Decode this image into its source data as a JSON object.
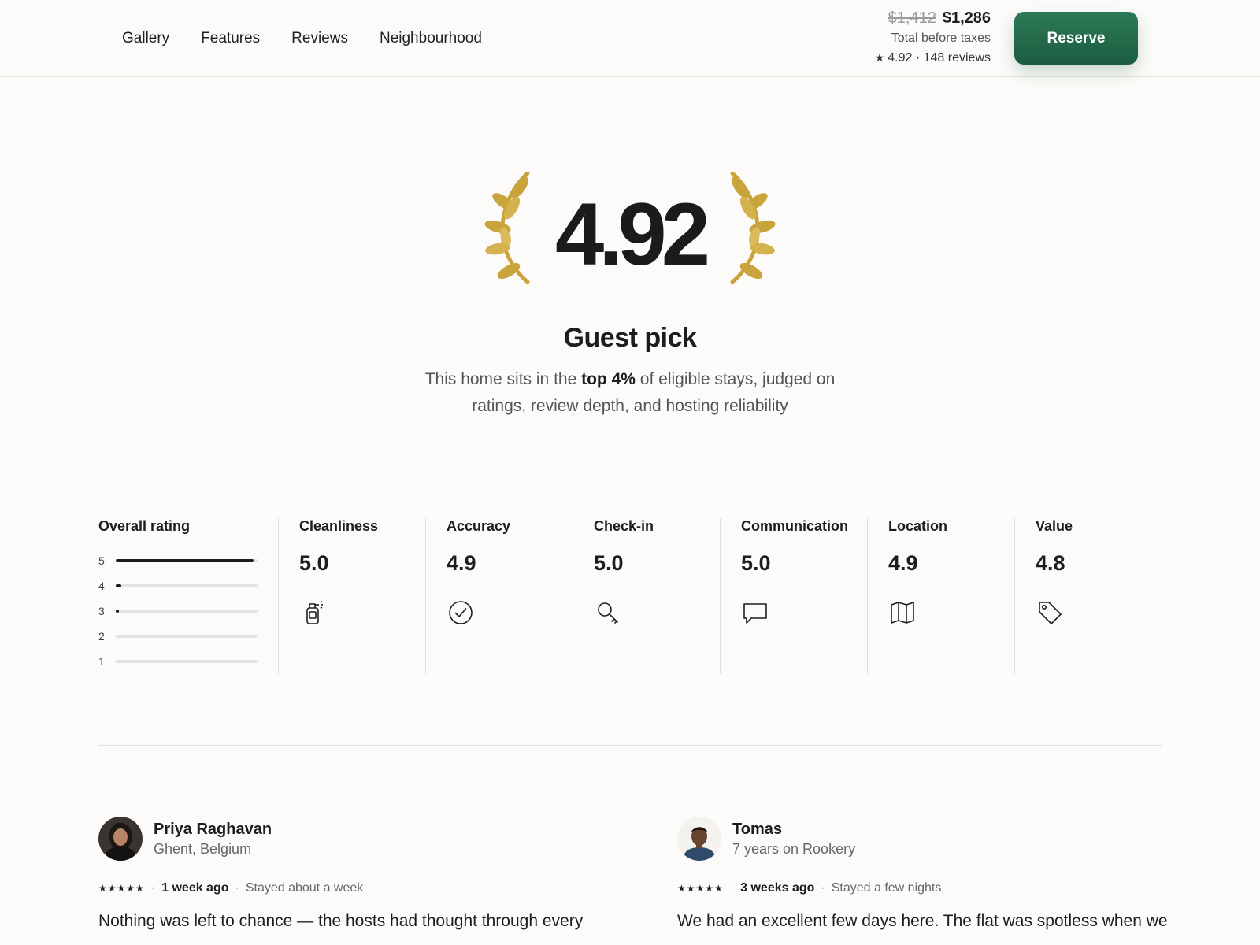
{
  "nav": {
    "items": [
      "Gallery",
      "Features",
      "Reviews",
      "Neighbourhood"
    ]
  },
  "booking": {
    "price_original": "$1,412",
    "price_current": "$1,286",
    "price_note": "Total before taxes",
    "rating_summary": "4.92 · 148 reviews",
    "reserve_label": "Reserve",
    "accent_color": "#1f6547"
  },
  "hero": {
    "score": "4.92",
    "title": "Guest pick",
    "desc_before": "This home sits in the ",
    "desc_bold": "top 4%",
    "desc_after": " of eligible stays, judged on ratings, review depth, and hosting reliability",
    "laurel_color": "#c9a33c"
  },
  "overall": {
    "title": "Overall rating",
    "bars": [
      {
        "label": "5",
        "fraction": 0.97
      },
      {
        "label": "4",
        "fraction": 0.04
      },
      {
        "label": "3",
        "fraction": 0.01
      },
      {
        "label": "2",
        "fraction": 0.0
      },
      {
        "label": "1",
        "fraction": 0.0
      }
    ]
  },
  "categories": [
    {
      "title": "Cleanliness",
      "value": "5.0",
      "icon": "spray-bottle-icon"
    },
    {
      "title": "Accuracy",
      "value": "4.9",
      "icon": "check-circle-icon"
    },
    {
      "title": "Check-in",
      "value": "5.0",
      "icon": "key-icon"
    },
    {
      "title": "Communication",
      "value": "5.0",
      "icon": "chat-bubble-icon"
    },
    {
      "title": "Location",
      "value": "4.9",
      "icon": "map-icon"
    },
    {
      "title": "Value",
      "value": "4.8",
      "icon": "price-tag-icon"
    }
  ],
  "reviews": [
    {
      "name": "Priya Raghavan",
      "subtitle": "Ghent, Belgium",
      "stars": "★★★★★",
      "when": "1 week ago",
      "stay": "Stayed about a week",
      "text": "Nothing was left to chance — the hosts had thought through every"
    },
    {
      "name": "Tomas",
      "subtitle": "7 years on Rookery",
      "stars": "★★★★★",
      "when": "3 weeks ago",
      "stay": "Stayed a few nights",
      "text": "We had an excellent few days here. The flat was spotless when we"
    }
  ]
}
